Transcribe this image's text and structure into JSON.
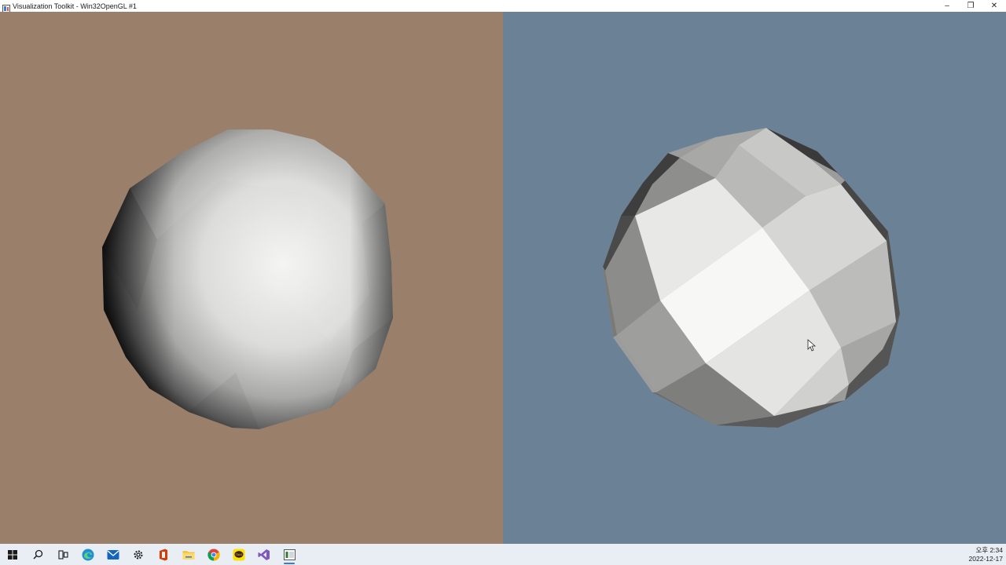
{
  "window": {
    "title": "Visualization Toolkit - Win32OpenGL #1",
    "controls": {
      "minimize": "–",
      "restore": "❐",
      "close": "✕"
    }
  },
  "viewports": {
    "left": {
      "background": "#9a806a",
      "object": "smooth-shaded-sphere"
    },
    "right": {
      "background": "#6a8196",
      "object": "flat-shaded-sphere"
    }
  },
  "taskbar": {
    "items": [
      {
        "icon": "windows-start-icon"
      },
      {
        "icon": "search-icon"
      },
      {
        "icon": "task-view-icon"
      },
      {
        "icon": "edge-icon"
      },
      {
        "icon": "mail-icon"
      },
      {
        "icon": "settings-icon"
      },
      {
        "icon": "office-icon"
      },
      {
        "icon": "file-explorer-icon"
      },
      {
        "icon": "chrome-icon"
      },
      {
        "icon": "kakaotalk-icon"
      },
      {
        "icon": "visual-studio-icon"
      },
      {
        "icon": "vtk-window-icon",
        "active": true
      }
    ],
    "clock": {
      "time": "오후 2:34",
      "date": "2022-12-17"
    }
  }
}
